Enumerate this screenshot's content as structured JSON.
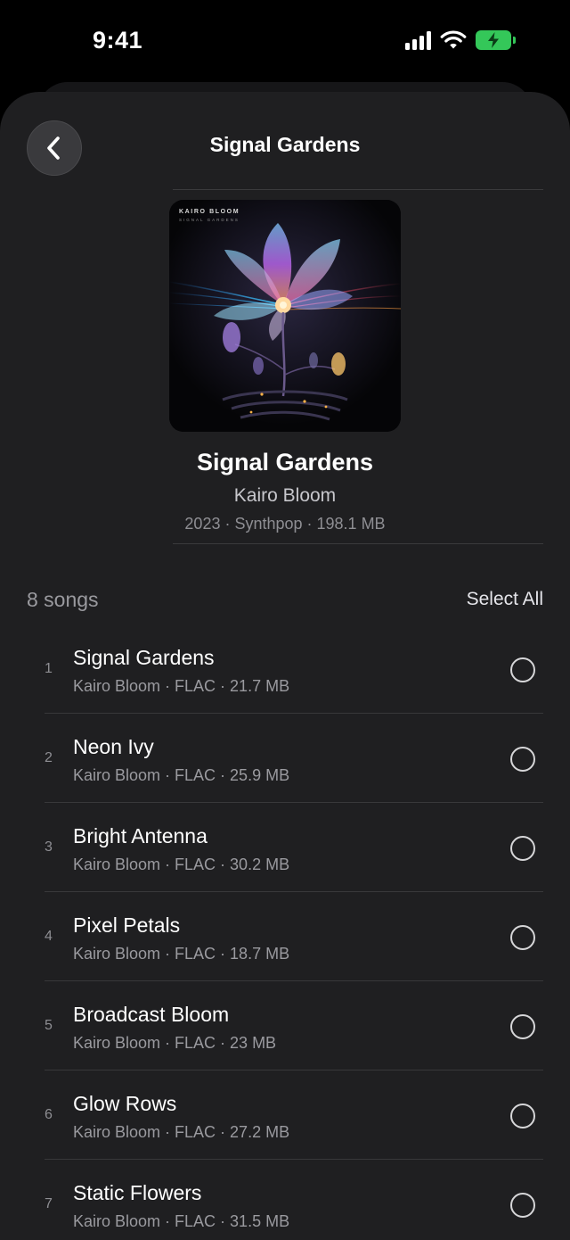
{
  "status_bar": {
    "time": "9:41"
  },
  "nav": {
    "title": "Signal Gardens"
  },
  "cover": {
    "artist_text": "KAIRO BLOOM",
    "album_text": "SIGNAL GARDENS"
  },
  "album": {
    "title": "Signal Gardens",
    "artist": "Kairo Bloom",
    "meta": "2023 · Synthpop · 198.1 MB"
  },
  "list": {
    "count_label": "8 songs",
    "select_all_label": "Select All"
  },
  "tracks": [
    {
      "number": "1",
      "title": "Signal Gardens",
      "subtitle": "Kairo Bloom · FLAC · 21.7 MB"
    },
    {
      "number": "2",
      "title": "Neon Ivy",
      "subtitle": "Kairo Bloom · FLAC · 25.9 MB"
    },
    {
      "number": "3",
      "title": "Bright Antenna",
      "subtitle": "Kairo Bloom · FLAC · 30.2 MB"
    },
    {
      "number": "4",
      "title": "Pixel Petals",
      "subtitle": "Kairo Bloom · FLAC · 18.7 MB"
    },
    {
      "number": "5",
      "title": "Broadcast Bloom",
      "subtitle": "Kairo Bloom · FLAC · 23 MB"
    },
    {
      "number": "6",
      "title": "Glow Rows",
      "subtitle": "Kairo Bloom · FLAC · 27.2 MB"
    },
    {
      "number": "7",
      "title": "Static Flowers",
      "subtitle": "Kairo Bloom · FLAC · 31.5 MB"
    }
  ],
  "colors": {
    "background": "#000000",
    "sheet": "#1f1f21",
    "battery": "#34c759",
    "secondary_text": "#9a9a9f"
  },
  "icons": {
    "back": "chevron-left-icon",
    "signal": "cellular-signal-icon",
    "wifi": "wifi-icon",
    "battery": "battery-charging-icon",
    "checkbox": "circle-outline-icon"
  }
}
